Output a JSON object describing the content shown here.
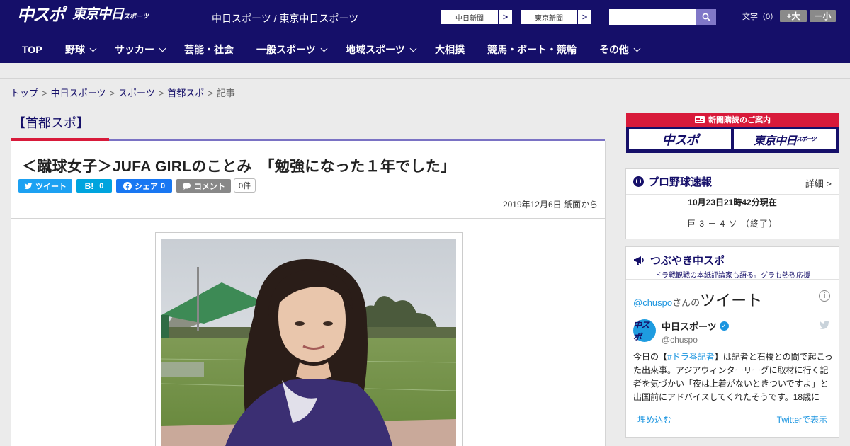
{
  "header": {
    "logo_main": "中スポ",
    "logo_tokyo": "東京中日",
    "logo_tokyo_small": "スポーツ",
    "site_name": "中日スポーツ / 東京中日スポーツ",
    "ext_links": [
      {
        "label": "中日新聞",
        "arrow": ">"
      },
      {
        "label": "東京新聞",
        "arrow": ">"
      }
    ],
    "search_placeholder": "",
    "fontsize_label": "文字（0）",
    "font_plus": "+大",
    "font_minus": "－小"
  },
  "nav": {
    "items": [
      {
        "label": "TOP",
        "dropdown": false
      },
      {
        "label": "野球",
        "dropdown": true
      },
      {
        "label": "サッカー",
        "dropdown": true
      },
      {
        "label": "芸能・社会",
        "dropdown": false
      },
      {
        "label": "一般スポーツ",
        "dropdown": true
      },
      {
        "label": "地域スポーツ",
        "dropdown": true
      },
      {
        "label": "大相撲",
        "dropdown": false
      },
      {
        "label": "競馬・ボート・競輪",
        "dropdown": false
      },
      {
        "label": "その他",
        "dropdown": true
      }
    ]
  },
  "breadcrumb": {
    "items": [
      "トップ",
      "中日スポーツ",
      "スポーツ",
      "首都スポ"
    ],
    "current": "記事",
    "separator": ">"
  },
  "article": {
    "section": "【首都スポ】",
    "headline": "＜蹴球女子＞JUFA GIRLのことみ　「勉強になった１年でした」",
    "share": {
      "tweet": "ツイート",
      "hatena": "B!",
      "hatena_count": "0",
      "facebook": "シェア",
      "facebook_count": "0",
      "comment": "コメント",
      "comment_count": "0件"
    },
    "date": "2019年12月6日 紙面から"
  },
  "sidebar": {
    "subscription": {
      "title": "新聞購読のご案内",
      "left": "中スポ",
      "right": "東京中日",
      "right_small": "スポーツ"
    },
    "baseball": {
      "title": "プロ野球速報",
      "detail": "詳細 >",
      "time": "10月23日21時42分現在",
      "score": "巨 3 － 4 ソ （終了）"
    },
    "twitter": {
      "title": "つぶやき中スポ",
      "subtitle": "ドラ戦観戦の本紙評論家も語る。グラも熱烈応援",
      "handle": "@chuspo",
      "handle_suffix": "さんの",
      "tweets_word": "ツイート",
      "user_name": "中日スポーツ",
      "user_acct": "@chuspo",
      "avatar_text": "中スポ",
      "text_pre": "今日の【",
      "text_tag": "#ドラ番記者",
      "text_post": "】は記者と石橋との間で起こった出来事。アジアウィンターリーグに取材に行く記者を気づかい「夜は上着がないときついですよ」と出国前にアドバイスしてくれたそうです。18歳に",
      "embed": "埋め込む",
      "view_on": "Twitterで表示"
    }
  },
  "colors": {
    "brand": "#150f69",
    "accent_red": "#d81a3a",
    "twitter_blue": "#1da1f2",
    "facebook_blue": "#1877f2",
    "hatena_blue": "#00a4de"
  }
}
